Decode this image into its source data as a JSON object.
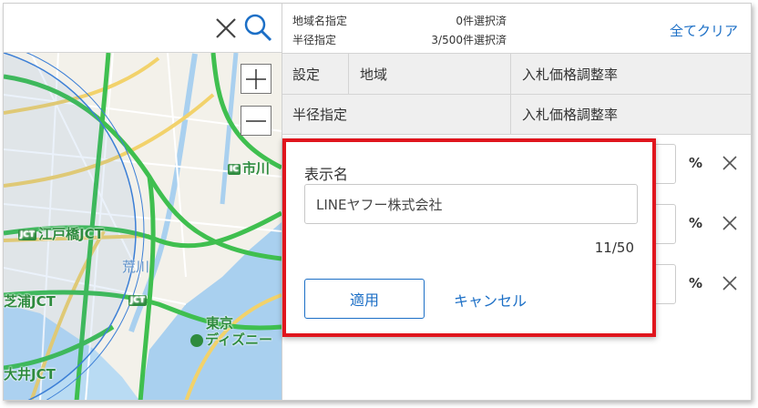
{
  "map": {
    "search_clear_icon": "close-icon",
    "search_icon": "search-icon",
    "zoom_in_icon": "plus-icon",
    "zoom_out_icon": "minus-icon",
    "labels": {
      "ichikawa": "市川",
      "edobashi": "江戸橋JCT",
      "arakawa": "荒川",
      "shibaura": "芝浦JCT",
      "jct_badge": "JCT",
      "tokyo": "東京",
      "disney": "ディズニー",
      "oi": "大井JCT",
      "ic_badge": "IC",
      "jct_small": "JCT"
    },
    "colors": {
      "road_green": "#3fbf4f",
      "road_yellow": "#f2d26b",
      "water": "#a9d0ef",
      "radius_circle": "#3c7fd6"
    }
  },
  "summary": {
    "region_label": "地域名指定",
    "region_count": "0件選択済",
    "radius_label": "半径指定",
    "radius_count": "3/500件選択済",
    "clear_all": "全てクリア"
  },
  "table": {
    "header1": {
      "setting": "設定",
      "region": "地域",
      "rate": "入札価格調整率"
    },
    "header2": {
      "radius": "半径指定",
      "rate": "入札価格調整率"
    },
    "rows": [
      {
        "pct": "%"
      },
      {
        "pct": "%"
      },
      {
        "pct": "%"
      }
    ]
  },
  "popup": {
    "title": "表示名",
    "value": "LINEヤフー株式会社",
    "counter": "11/50",
    "apply": "適用",
    "cancel": "キャンセル",
    "border_color": "#e0151d",
    "accent_color": "#1c6fc6"
  }
}
